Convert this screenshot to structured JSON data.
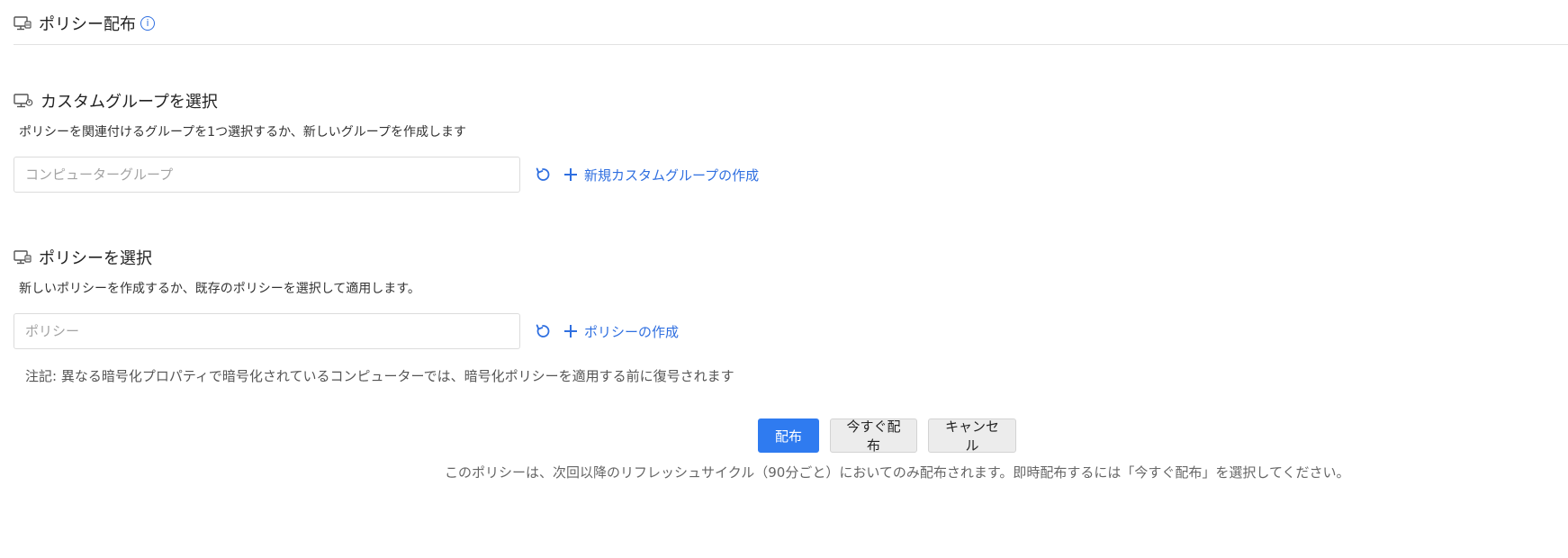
{
  "header": {
    "title": "ポリシー配布",
    "info_icon": "i"
  },
  "group_section": {
    "title": "カスタムグループを選択",
    "description": "ポリシーを関連付けるグループを1つ選択するか、新しいグループを作成します",
    "input_placeholder": "コンピューターグループ",
    "create_link": "新規カスタムグループの作成"
  },
  "policy_section": {
    "title": "ポリシーを選択",
    "description": "新しいポリシーを作成するか、既存のポリシーを選択して適用します。",
    "input_placeholder": "ポリシー",
    "create_link": "ポリシーの作成"
  },
  "note": "注記: 異なる暗号化プロパティで暗号化されているコンピューターでは、暗号化ポリシーを適用する前に復号されます",
  "actions": {
    "deploy_label": "配布",
    "deploy_now_label": "今すぐ配布",
    "cancel_label": "キャンセル"
  },
  "footnote": "このポリシーは、次回以降のリフレッシュサイクル（90分ごと）においてのみ配布されます。即時配布するには「今すぐ配布」を選択してください。",
  "colors": {
    "accent": "#2f6fe0",
    "primary_button": "#2f7bf0"
  },
  "icons": {
    "header": "monitor-policy-icon",
    "group": "monitor-group-icon",
    "policy": "monitor-policy-icon",
    "refresh": "refresh-icon",
    "add": "plus-icon"
  }
}
